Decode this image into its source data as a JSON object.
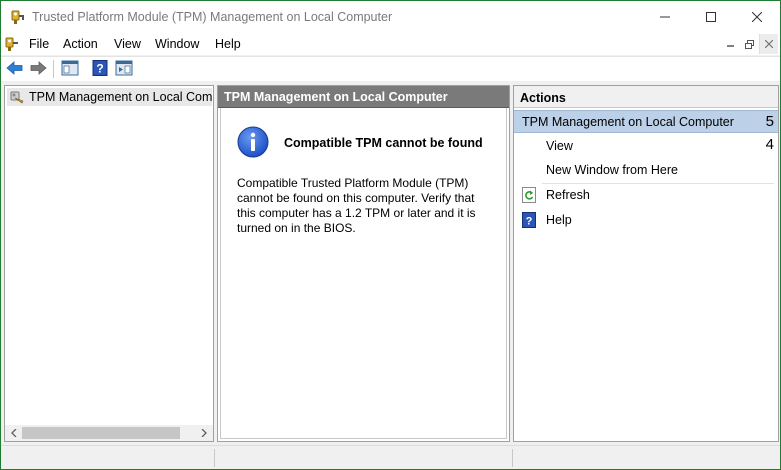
{
  "window": {
    "title": "Trusted Platform Module (TPM) Management on Local Computer",
    "frame_color": "#1e7d32"
  },
  "menu": {
    "items": [
      "File",
      "Action",
      "View",
      "Window",
      "Help"
    ],
    "mdi_buttons": [
      "minimize",
      "restore",
      "close"
    ]
  },
  "toolbar": {
    "buttons": [
      "back-arrow-icon",
      "forward-arrow-icon",
      "show-hide-console-tree-icon",
      "help-icon",
      "show-hide-action-pane-icon"
    ]
  },
  "tree": {
    "selected_item": "TPM Management on Local Comp"
  },
  "center": {
    "header": "TPM Management on Local Computer",
    "message": {
      "heading": "Compatible TPM cannot be found",
      "body": "Compatible Trusted Platform Module (TPM) cannot be found on this computer. Verify that this computer has a 1.2 TPM or later and it is turned on in the BIOS."
    }
  },
  "actions": {
    "title": "Actions",
    "section": {
      "label": "TPM Management on Local Computer",
      "arrow": "5"
    },
    "items": [
      {
        "label": "View",
        "arrow": "4",
        "icon": ""
      },
      {
        "label": "New Window from Here",
        "arrow": "",
        "icon": ""
      },
      {
        "label": "Refresh",
        "arrow": "",
        "icon": "refresh-icon"
      },
      {
        "label": "Help",
        "arrow": "",
        "icon": "help-icon"
      }
    ]
  },
  "colors": {
    "accent_selection": "#bcd0e8",
    "header_gray": "#7a7a7a",
    "info_blue": "#1e50c8"
  }
}
